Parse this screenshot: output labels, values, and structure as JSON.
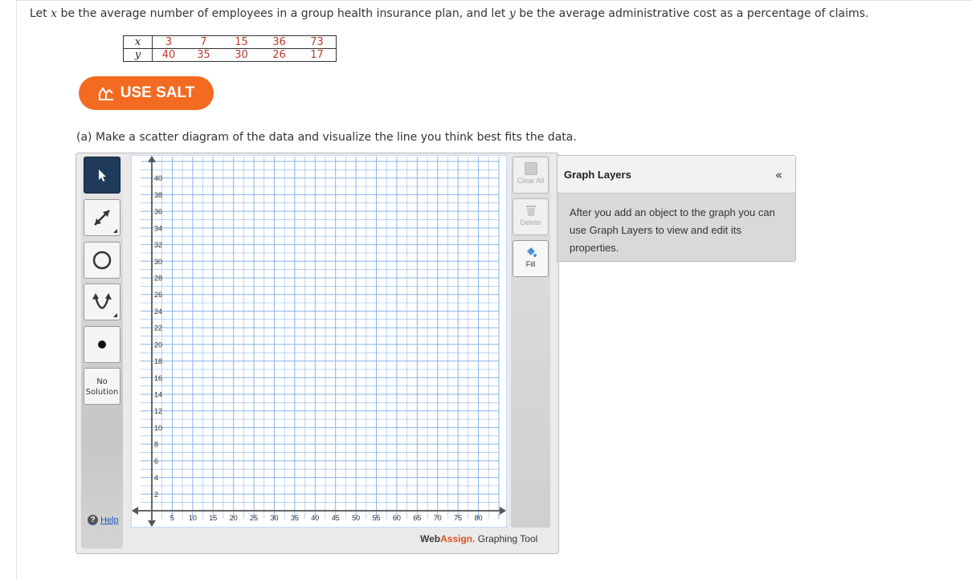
{
  "question": {
    "intro_parts": [
      "Let ",
      "x",
      " be the average number of employees in a group health insurance plan, and let ",
      "y",
      " be the average administrative cost as a percentage of claims."
    ]
  },
  "table": {
    "x_label": "x",
    "y_label": "y",
    "x_values": [
      "3",
      "7",
      "15",
      "36",
      "73"
    ],
    "y_values": [
      "40",
      "35",
      "30",
      "26",
      "17"
    ]
  },
  "salt_button": {
    "label": "USE SALT",
    "icon": "salt-chart-icon"
  },
  "part_a": {
    "text": "(a) Make a scatter diagram of the data and visualize the line you think best fits the data."
  },
  "toolbar": {
    "tools": [
      {
        "name": "pointer",
        "icon": "pointer-arrow-icon",
        "active": true
      },
      {
        "name": "line",
        "icon": "line-tool-icon"
      },
      {
        "name": "circle",
        "icon": "circle-tool-icon"
      },
      {
        "name": "parabola",
        "icon": "parabola-tool-icon"
      },
      {
        "name": "point",
        "icon": "point-tool-icon"
      }
    ],
    "no_solution_line1": "No",
    "no_solution_line2": "Solution",
    "help_label": "Help"
  },
  "right_tools": {
    "clear_all": "Clear All",
    "delete": "Delete",
    "fill": "Fill"
  },
  "chart_data": {
    "type": "scatter",
    "x_ticks": [
      5,
      10,
      15,
      20,
      25,
      30,
      35,
      40,
      45,
      50,
      55,
      60,
      65,
      70,
      75,
      80
    ],
    "y_ticks": [
      2,
      4,
      6,
      8,
      10,
      12,
      14,
      16,
      18,
      20,
      22,
      24,
      26,
      28,
      30,
      32,
      34,
      36,
      38,
      40
    ],
    "xlim": [
      0,
      85
    ],
    "ylim": [
      0,
      42
    ],
    "grid": true,
    "points": []
  },
  "branding": {
    "web": "Web",
    "assign": "Assign.",
    "rest": " Graphing Tool"
  },
  "graph_layers": {
    "title": "Graph Layers",
    "collapse": "«",
    "body": "After you add an object to the graph you can use Graph Layers to view and edit its properties.",
    "colors": {
      "accent": "#f36b21",
      "active_tool": "#203a5c",
      "grid": "#8ab4e8"
    }
  }
}
